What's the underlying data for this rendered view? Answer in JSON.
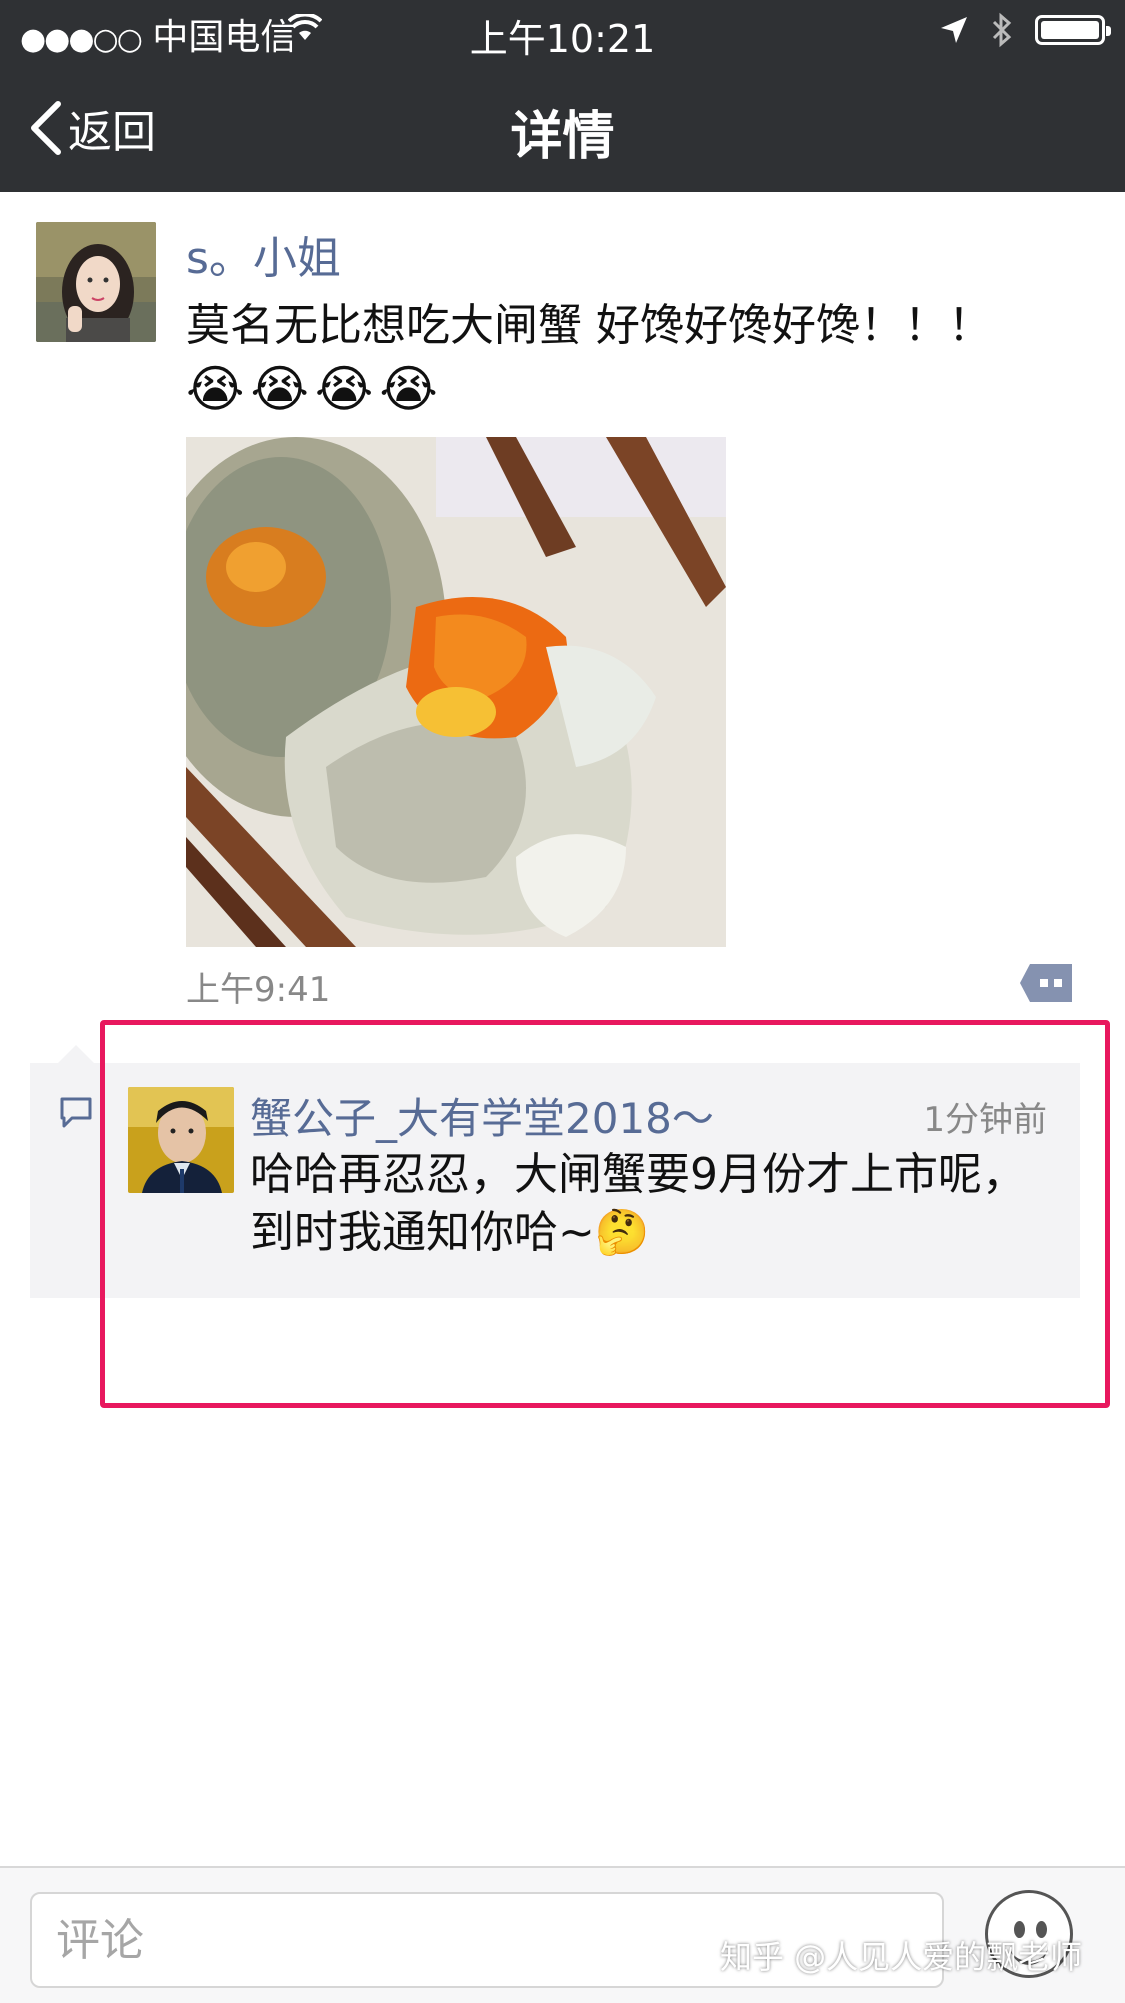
{
  "status_bar": {
    "signal": "●●●○○",
    "carrier": "中国电信",
    "time": "上午10:21"
  },
  "nav": {
    "back_label": "返回",
    "title": "详情"
  },
  "post": {
    "username": "s。小姐",
    "text": "莫名无比想吃大闸蟹 好馋好馋好馋！！！",
    "emojis": [
      "😭",
      "😭",
      "😭",
      "😭"
    ],
    "time": "上午9:41"
  },
  "comment": {
    "author": "蟹公子_大有学堂2018～",
    "time": "1分钟前",
    "text": "哈哈再忍忍，大闸蟹要9月份才上市呢，到时我通知你哈~",
    "emoji": "🤔"
  },
  "comment_input": {
    "placeholder": "评论"
  },
  "watermark": "知乎 @人见人爱的飘老师",
  "colors": {
    "name_link": "#576b95",
    "nav_bg": "#2f3134",
    "highlight": "#e8185e",
    "comment_bg": "#f3f3f5"
  }
}
